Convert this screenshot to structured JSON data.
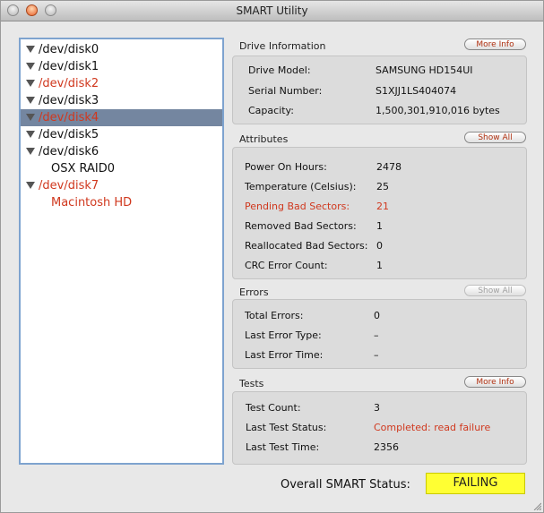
{
  "window": {
    "title": "SMART Utility"
  },
  "disks": [
    {
      "label": "/dev/disk0",
      "state": "normal"
    },
    {
      "label": "/dev/disk1",
      "state": "normal"
    },
    {
      "label": "/dev/disk2",
      "state": "failing"
    },
    {
      "label": "/dev/disk3",
      "state": "normal"
    },
    {
      "label": "/dev/disk4",
      "state": "failing",
      "selected": true
    },
    {
      "label": "/dev/disk5",
      "state": "normal"
    },
    {
      "label": "/dev/disk6",
      "state": "normal"
    },
    {
      "label": "OSX RAID0",
      "state": "normal",
      "child": true
    },
    {
      "label": "/dev/disk7",
      "state": "failing"
    },
    {
      "label": "Macintosh HD",
      "state": "failing",
      "child": true
    }
  ],
  "drive_info": {
    "title": "Drive Information",
    "button": "More Info",
    "model_label": "Drive Model:",
    "model_value": "SAMSUNG HD154UI",
    "serial_label": "Serial Number:",
    "serial_value": "S1XJJ1LS404074",
    "capacity_label": "Capacity:",
    "capacity_value": "1,500,301,910,016 bytes"
  },
  "attributes": {
    "title": "Attributes",
    "button": "Show All",
    "poh_label": "Power On Hours:",
    "poh_value": "2478",
    "temp_label": "Temperature (Celsius):",
    "temp_value": "25",
    "pending_label": "Pending Bad Sectors:",
    "pending_value": "21",
    "removed_label": "Removed Bad Sectors:",
    "removed_value": "1",
    "realloc_label": "Reallocated Bad Sectors:",
    "realloc_value": "0",
    "crc_label": "CRC Error Count:",
    "crc_value": "1"
  },
  "errors": {
    "title": "Errors",
    "button": "Show All",
    "total_label": "Total Errors:",
    "total_value": "0",
    "type_label": "Last Error Type:",
    "type_value": "–",
    "time_label": "Last Error Time:",
    "time_value": "–"
  },
  "tests": {
    "title": "Tests",
    "button": "More Info",
    "count_label": "Test Count:",
    "count_value": "3",
    "status_label": "Last Test Status:",
    "status_value": "Completed: read failure",
    "time_label": "Last Test Time:",
    "time_value": "2356"
  },
  "overall": {
    "label": "Overall SMART Status:",
    "value": "FAILING",
    "color": "#ffff33"
  },
  "colors": {
    "failing_text": "#d0381e",
    "selection": "#7486a0"
  }
}
